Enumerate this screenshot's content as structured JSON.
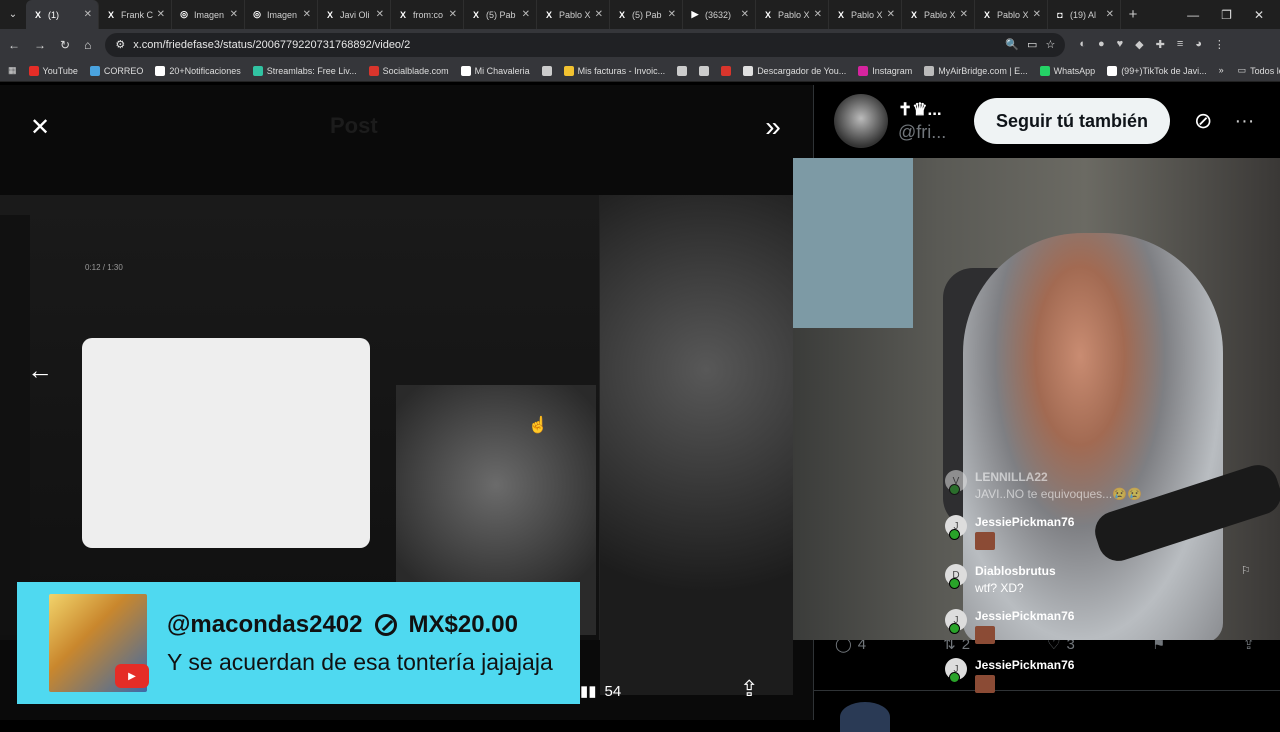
{
  "browser": {
    "tabs": [
      {
        "title": "(1)",
        "fav": "X",
        "active": true
      },
      {
        "title": "Frank C",
        "fav": "X"
      },
      {
        "title": "Imagen",
        "fav": "◎"
      },
      {
        "title": "Imagen",
        "fav": "◎"
      },
      {
        "title": "Javi Oli",
        "fav": "X"
      },
      {
        "title": "from:co",
        "fav": "X"
      },
      {
        "title": "(5) Pab",
        "fav": "X"
      },
      {
        "title": "Pablo X",
        "fav": "X"
      },
      {
        "title": "(5) Pab",
        "fav": "X"
      },
      {
        "title": "(3632)",
        "fav": "▶"
      },
      {
        "title": "Pablo X",
        "fav": "X"
      },
      {
        "title": "Pablo X",
        "fav": "X"
      },
      {
        "title": "Pablo X",
        "fav": "X"
      },
      {
        "title": "Pablo X",
        "fav": "X"
      },
      {
        "title": "(19) Al",
        "fav": "◘"
      }
    ],
    "url": "x.com/friedefase3/status/2006779220731768892/video/2",
    "bookmarks": [
      {
        "label": "YouTube",
        "color": "#e52d27"
      },
      {
        "label": "CORREO",
        "color": "#4aa3df"
      },
      {
        "label": "20+Notificaciones",
        "color": "#ffffff"
      },
      {
        "label": "Streamlabs: Free Liv...",
        "color": "#31c3a2"
      },
      {
        "label": "Socialblade.com",
        "color": "#d9352c"
      },
      {
        "label": "Mi Chavaleria",
        "color": "#ffffff"
      },
      {
        "label": "",
        "color": "#cccccc"
      },
      {
        "label": "Mis facturas - Invoic...",
        "color": "#f2c230"
      },
      {
        "label": "",
        "color": "#cccccc"
      },
      {
        "label": "",
        "color": "#cccccc"
      },
      {
        "label": "",
        "color": "#d9352c"
      },
      {
        "label": "Descargador de You...",
        "color": "#e0e0e0"
      },
      {
        "label": "Instagram",
        "color": "#d6249f"
      },
      {
        "label": "MyAirBridge.com | E...",
        "color": "#bbbbbb"
      },
      {
        "label": "WhatsApp",
        "color": "#25d366"
      },
      {
        "label": "(99+)TikTok de Javi...",
        "color": "#ffffff"
      }
    ],
    "bookmarks_more": "»",
    "all_bookmarks": "Todos los marcadores"
  },
  "media": {
    "views": "54",
    "ghost_title": "Post",
    "player_time": "0:12 / 1:30"
  },
  "donation": {
    "username": "@macondas2402",
    "amount": "MX$20.00",
    "message": "Y se acuerdan de esa tontería jajajaja",
    "badge": "▶"
  },
  "side": {
    "display_name": "✝♛...",
    "handle": "@fri...",
    "follow_label": "Seguir tú también",
    "actions": [
      {
        "icon": "reply-icon",
        "glyph": "◯",
        "count": "4"
      },
      {
        "icon": "repost-icon",
        "glyph": "⇅",
        "count": "2"
      },
      {
        "icon": "like-icon",
        "glyph": "♡",
        "count": "3"
      },
      {
        "icon": "bookmark-icon",
        "glyph": "⚑",
        "count": ""
      },
      {
        "icon": "share-icon",
        "glyph": "⇪",
        "count": ""
      }
    ]
  },
  "chat": [
    {
      "initial": "V",
      "name": "LENNILLA22",
      "text": "JAVI..NO te equivoques...😢😢",
      "faded": true
    },
    {
      "initial": "J",
      "name": "JessiePickman76",
      "text": "",
      "emote": true
    },
    {
      "initial": "D",
      "name": "Diablosbrutus",
      "text": "wtf? XD?",
      "flag": true
    },
    {
      "initial": "J",
      "name": "JessiePickman76",
      "text": "",
      "emote": true
    },
    {
      "initial": "J",
      "name": "JessiePickman76",
      "text": "",
      "emote": true
    }
  ]
}
